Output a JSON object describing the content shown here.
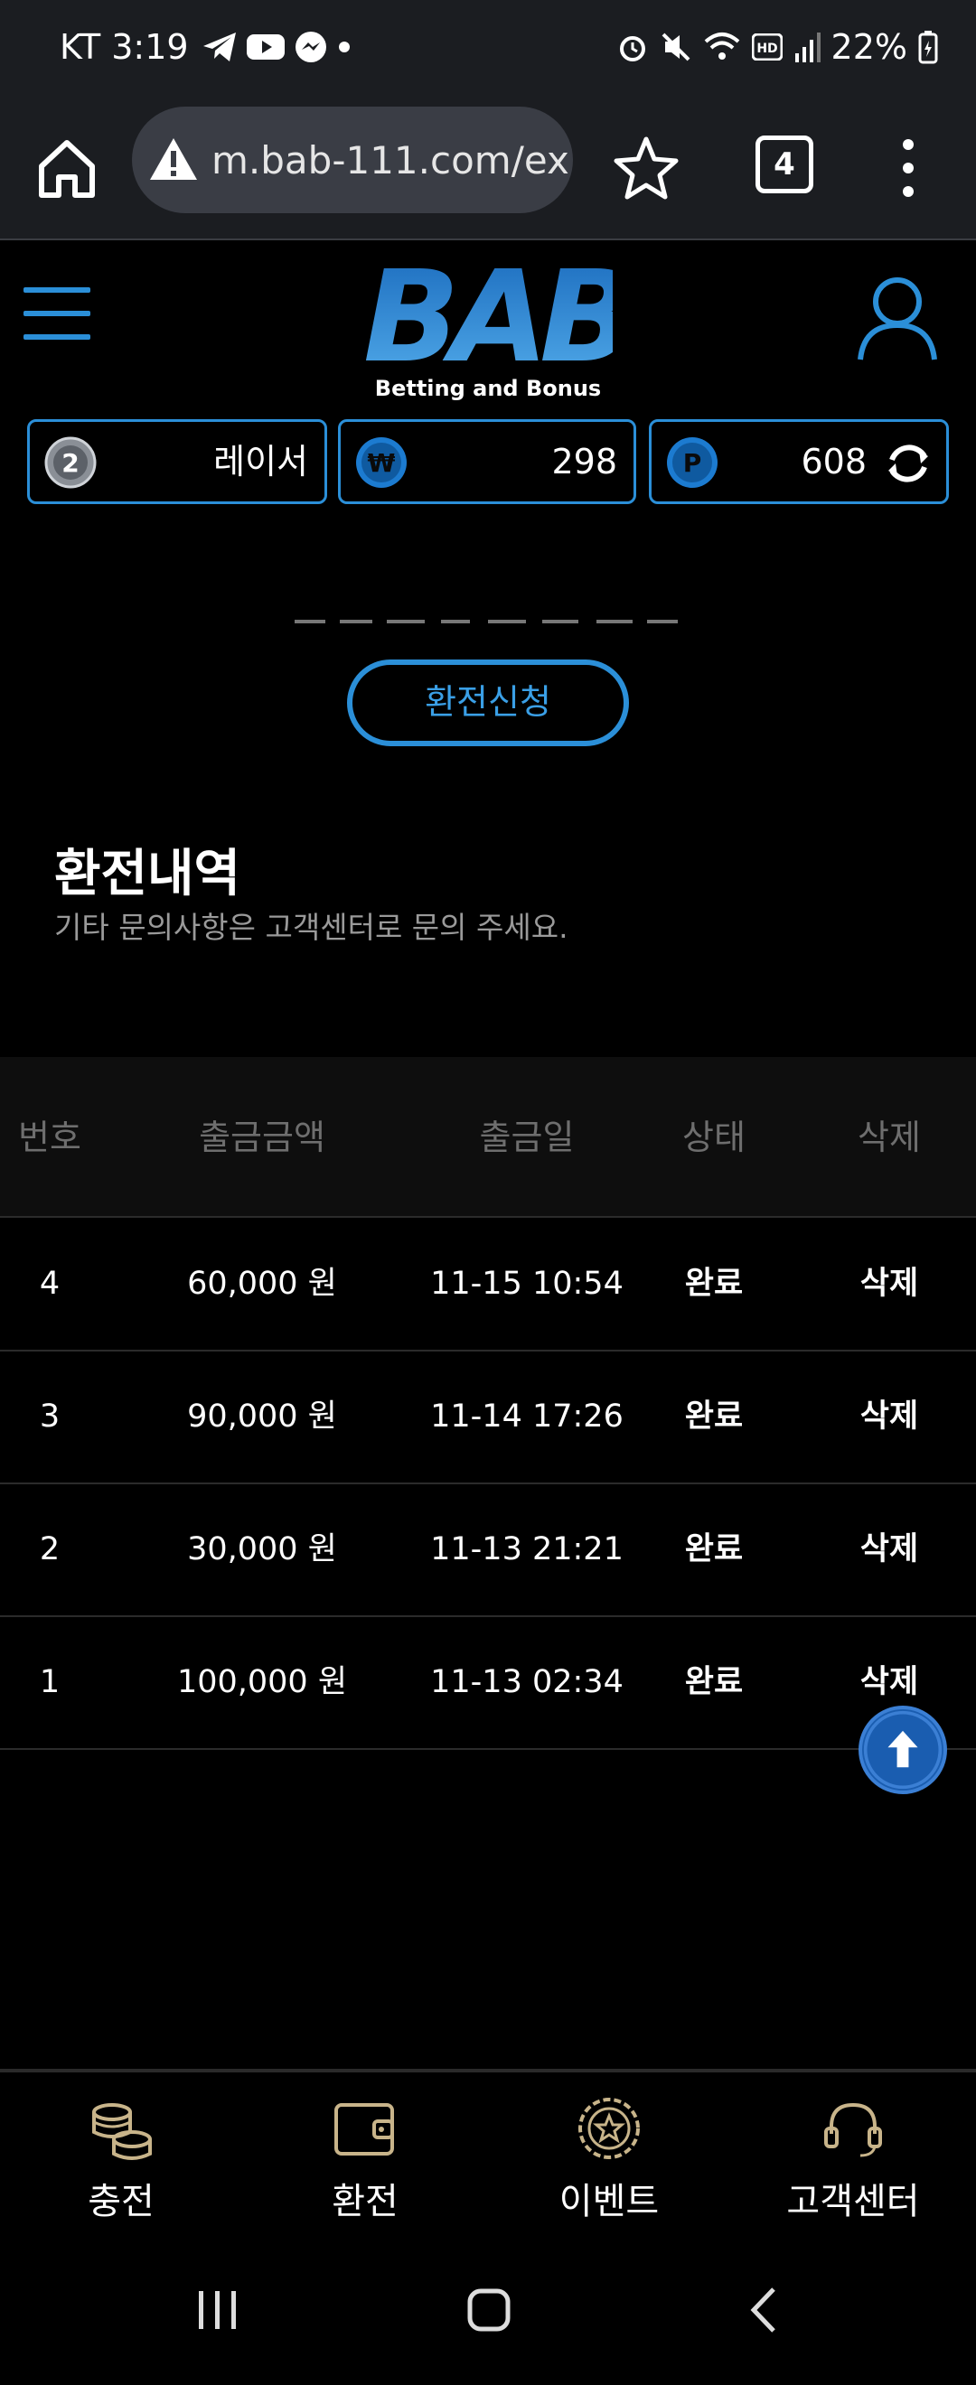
{
  "status_bar": {
    "carrier_time": "KT 3:19",
    "battery": "22%"
  },
  "browser": {
    "url": "m.bab-111.com/ex",
    "tab_count": "4"
  },
  "site": {
    "logo_text": "BAB",
    "logo_tagline": "Betting and Bonus",
    "level_name": "레이서",
    "money": "298",
    "points": "608"
  },
  "apply_button": "환전신청",
  "section": {
    "title": "환전내역",
    "subtitle": "기타 문의사항은 고객센터로 문의 주세요."
  },
  "table": {
    "headers": [
      "번호",
      "출금금액",
      "출금일",
      "상태",
      "삭제"
    ],
    "rows": [
      {
        "no": "4",
        "amount": "60,000 원",
        "date": "11-15 10:54",
        "status": "완료",
        "delete": "삭제"
      },
      {
        "no": "3",
        "amount": "90,000 원",
        "date": "11-14 17:26",
        "status": "완료",
        "delete": "삭제"
      },
      {
        "no": "2",
        "amount": "30,000 원",
        "date": "11-13 21:21",
        "status": "완료",
        "delete": "삭제"
      },
      {
        "no": "1",
        "amount": "100,000 원",
        "date": "11-13 02:34",
        "status": "완료",
        "delete": "삭제"
      }
    ]
  },
  "bottom_nav": [
    {
      "label": "충전",
      "icon": "coins-icon"
    },
    {
      "label": "환전",
      "icon": "wallet-icon"
    },
    {
      "label": "이벤트",
      "icon": "star-badge-icon"
    },
    {
      "label": "고객센터",
      "icon": "headset-icon"
    }
  ],
  "colors": {
    "accent": "#2b8fd8",
    "background": "#000000",
    "nav_icon": "#c8b48a"
  }
}
